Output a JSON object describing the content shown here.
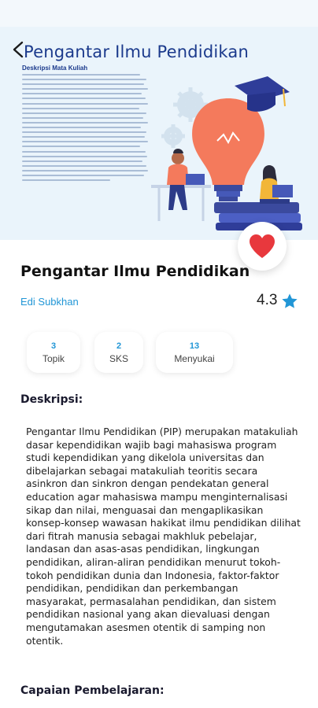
{
  "header": {
    "title": "Pengantar Ilmu Pendidikan",
    "banner_subheading": "Deskripsi Mata Kuliah"
  },
  "course": {
    "title": "Pengantar Ilmu Pendidikan",
    "instructor": "Edi Subkhan",
    "rating": "4.3"
  },
  "stats": [
    {
      "value": "3",
      "label": "Topik"
    },
    {
      "value": "2",
      "label": "SKS"
    },
    {
      "value": "13",
      "label": "Menyukai"
    }
  ],
  "description": {
    "heading": "Deskripsi:",
    "text": "Pengantar Ilmu Pendidikan (PIP) merupakan matakuliah dasar kependidikan wajib bagi mahasiswa program studi kependidikan yang dikelola universitas dan dibelajarkan sebagai matakuliah teoritis secara asinkron dan sinkron dengan pendekatan general education agar mahasiswa mampu menginternalisasi sikap dan nilai, menguasai dan mengaplikasikan konsep-konsep wawasan hakikat ilmu pendidikan dilihat dari fitrah manusia sebagai makhluk pebelajar, landasan dan asas-asas pendidikan, lingkungan pendidikan, aliran-aliran pendidikan menurut tokoh-tokoh pendidikan dunia dan Indonesia, faktor-faktor pendidikan, pendidikan dan perkembangan masyarakat, permasalahan pendidikan, dan sistem pendidikan nasional yang akan dievaluasi dengan mengutamakan asesmen otentik di samping non otentik."
  },
  "learning_outcomes": {
    "heading": "Capaian Pembelajaran:"
  },
  "icons": {
    "back": "chevron-left-icon",
    "favorite": "heart-icon",
    "rating": "star-icon"
  },
  "colors": {
    "primary": "#1b3a8c",
    "accent": "#2196d6",
    "heart": "#e8383d",
    "star": "#2196d6",
    "banner_bg": "#eaf4fb"
  }
}
